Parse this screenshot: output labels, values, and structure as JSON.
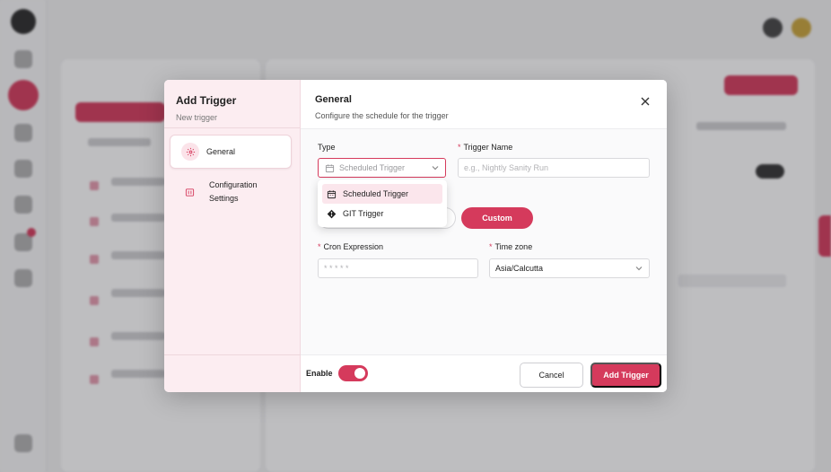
{
  "modal": {
    "title": "Add Trigger",
    "subtitle": "New trigger",
    "nav": [
      {
        "label": "General",
        "icon": "gear-icon"
      },
      {
        "label": "Configuration Settings",
        "icon": "sliders-icon"
      }
    ],
    "section_title": "General",
    "section_subtitle": "Configure the schedule for the trigger",
    "type": {
      "label": "Type",
      "value": "Scheduled Trigger",
      "icon": "calendar-icon"
    },
    "trigger_name": {
      "label": "Trigger Name",
      "placeholder": "e.g., Nightly Sanity Run"
    },
    "type_options": [
      {
        "label": "Scheduled Trigger",
        "icon": "calendar-icon",
        "selected": true
      },
      {
        "label": "GIT Trigger",
        "icon": "git-icon",
        "selected": false
      }
    ],
    "schedule_option_selected": "Custom",
    "cron": {
      "label": "Cron Expression",
      "placeholder": "* * * * *"
    },
    "timezone": {
      "label": "Time zone",
      "value": "Asia/Calcutta"
    },
    "enable": {
      "label": "Enable",
      "on": true
    },
    "cancel_label": "Cancel",
    "submit_label": "Add Trigger"
  },
  "colors": {
    "accent": "#d53a5c",
    "accent_light": "#fcedf1"
  }
}
